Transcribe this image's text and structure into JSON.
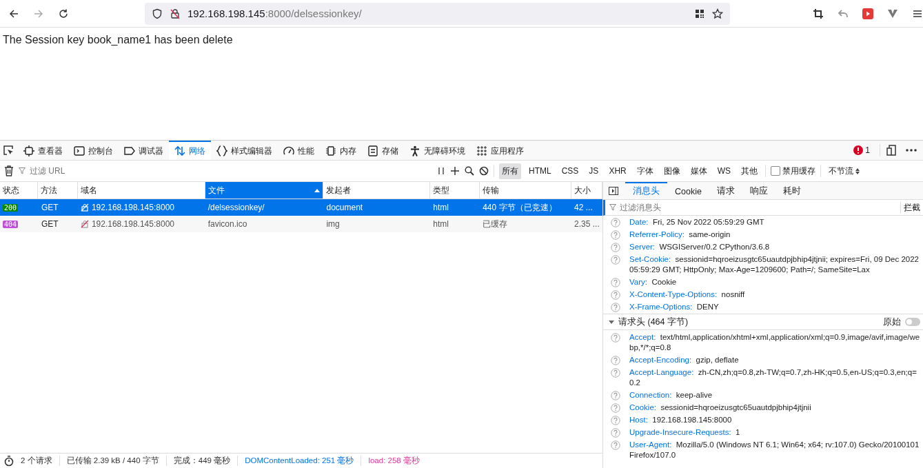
{
  "browser": {
    "url_host": "192.168.198.145",
    "url_rest": ":8000/delsessionkey/"
  },
  "page_text": "The Session key book_name1 has been delete",
  "devtools": {
    "tabs": [
      {
        "label": "查看器",
        "kind": "inspector",
        "selected": false
      },
      {
        "label": "控制台",
        "kind": "console",
        "selected": false
      },
      {
        "label": "调试器",
        "kind": "debugger",
        "selected": false
      },
      {
        "label": "网络",
        "kind": "network",
        "selected": true
      },
      {
        "label": "样式编辑器",
        "kind": "style",
        "selected": false
      },
      {
        "label": "性能",
        "kind": "performance",
        "selected": false
      },
      {
        "label": "内存",
        "kind": "memory",
        "selected": false
      },
      {
        "label": "存储",
        "kind": "storage",
        "selected": false
      },
      {
        "label": "无障碍环境",
        "kind": "accessibility",
        "selected": false
      },
      {
        "label": "应用程序",
        "kind": "application",
        "selected": false
      }
    ],
    "error_count": "1"
  },
  "toolbar": {
    "filter_placeholder": "过滤 URL",
    "type_filters": [
      {
        "label": "所有",
        "selected": true
      },
      {
        "label": "HTML",
        "selected": false
      },
      {
        "label": "CSS",
        "selected": false
      },
      {
        "label": "JS",
        "selected": false
      },
      {
        "label": "XHR",
        "selected": false
      },
      {
        "label": "字体",
        "selected": false
      },
      {
        "label": "图像",
        "selected": false
      },
      {
        "label": "媒体",
        "selected": false
      },
      {
        "label": "WS",
        "selected": false
      },
      {
        "label": "其他",
        "selected": false
      }
    ],
    "disable_cache": {
      "label": "禁用缓存",
      "checked": false
    },
    "throttle": "不节流"
  },
  "table": {
    "columns": [
      {
        "label": "状态",
        "sorted": false
      },
      {
        "label": "方法",
        "sorted": false
      },
      {
        "label": "域名",
        "sorted": false
      },
      {
        "label": "文件",
        "sorted": true
      },
      {
        "label": "发起者",
        "sorted": false
      },
      {
        "label": "类型",
        "sorted": false
      },
      {
        "label": "传输",
        "sorted": false
      },
      {
        "label": "大小",
        "sorted": false
      }
    ],
    "rows": [
      {
        "status": "200",
        "color": "#058b00",
        "method": "GET",
        "domain": "192.168.198.145:8000",
        "file": "/delsessionkey/",
        "initiator": "document",
        "type": "html",
        "transfer": "440 字节（已竞速）",
        "size": "42 ...",
        "selected": true
      },
      {
        "status": "404",
        "color": "#c24ee0",
        "method": "GET",
        "domain": "192.168.198.145:8000",
        "file": "favicon.ico",
        "initiator": "img",
        "type": "html",
        "transfer": "已缓存",
        "size": "2.35 ...",
        "selected": false
      }
    ]
  },
  "status_bar": [
    {
      "text": "2 个请求",
      "kind": "plain"
    },
    {
      "text": "已传输 2.39 kB / 440 字节",
      "kind": "plain"
    },
    {
      "text": "完成：449 毫秒",
      "kind": "plain"
    },
    {
      "text": "DOMContentLoaded: 251 毫秒",
      "kind": "dom"
    },
    {
      "text": "load: 258 毫秒",
      "kind": "load"
    }
  ],
  "panel": {
    "tabs": [
      {
        "label": "消息头",
        "selected": true
      },
      {
        "label": "Cookie",
        "selected": false
      },
      {
        "label": "请求",
        "selected": false
      },
      {
        "label": "响应",
        "selected": false
      },
      {
        "label": "耗时",
        "selected": false
      }
    ],
    "filter_placeholder": "过滤消息头",
    "block_label": "拦截",
    "response_headers": [
      {
        "name": "Date:",
        "value": "Fri, 25 Nov 2022 05:59:29 GMT"
      },
      {
        "name": "Referrer-Policy:",
        "value": "same-origin"
      },
      {
        "name": "Server:",
        "value": "WSGIServer/0.2 CPython/3.6.8"
      },
      {
        "name": "Set-Cookie:",
        "value": "sessionid=hqroeizusgtc65uautdpjbhip4jtjnii; expires=Fri, 09 Dec 2022 05:59:29 GMT; HttpOnly; Max-Age=1209600; Path=/; SameSite=Lax"
      },
      {
        "name": "Vary:",
        "value": "Cookie"
      },
      {
        "name": "X-Content-Type-Options:",
        "value": "nosniff"
      },
      {
        "name": "X-Frame-Options:",
        "value": "DENY"
      }
    ],
    "request_headers": {
      "title": "请求头 (464 字节)",
      "expanded": true,
      "raw_label": "原始",
      "raw_on": false,
      "items": [
        {
          "name": "Accept:",
          "value": "text/html,application/xhtml+xml,application/xml;q=0.9,image/avif,image/webp,*/*;q=0.8"
        },
        {
          "name": "Accept-Encoding:",
          "value": "gzip, deflate"
        },
        {
          "name": "Accept-Language:",
          "value": "zh-CN,zh;q=0.8,zh-TW;q=0.7,zh-HK;q=0.5,en-US;q=0.3,en;q=0.2"
        },
        {
          "name": "Connection:",
          "value": "keep-alive"
        },
        {
          "name": "Cookie:",
          "value": "sessionid=hqroeizusgtc65uautdpjbhip4jtjnii"
        },
        {
          "name": "Host:",
          "value": "192.168.198.145:8000"
        },
        {
          "name": "Upgrade-Insecure-Requests:",
          "value": "1"
        },
        {
          "name": "User-Agent:",
          "value": "Mozilla/5.0 (Windows NT 6.1; Win64; x64; rv:107.0) Gecko/20100101 Firefox/107.0"
        }
      ]
    }
  }
}
